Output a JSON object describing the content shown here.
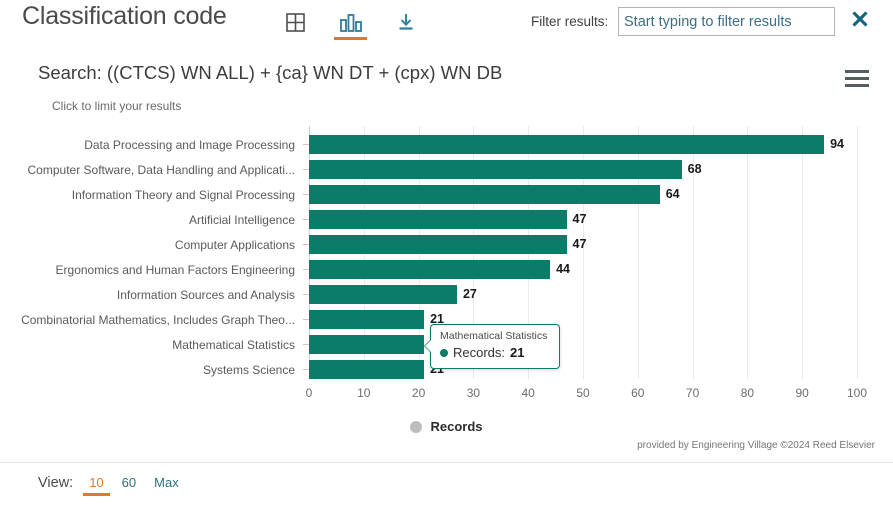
{
  "header": {
    "title": "Classification code",
    "icons": [
      {
        "name": "table-view-icon",
        "label": "Table view",
        "active": false
      },
      {
        "name": "bar-chart-view-icon",
        "label": "Bar chart view",
        "active": true
      },
      {
        "name": "download-icon",
        "label": "Download",
        "active": false
      }
    ],
    "filter_label": "Filter results:",
    "filter_placeholder": "Start typing to filter results",
    "filter_value": "",
    "close_label": "Close"
  },
  "search": {
    "line": "Search: ((CTCS) WN ALL) + {ca} WN DT + (cpx) WN DB",
    "hint": "Click to limit your results",
    "menu_label": "Options menu"
  },
  "chart_data": {
    "type": "bar",
    "orientation": "horizontal",
    "title": "",
    "xlabel": "",
    "ylabel": "",
    "xlim": [
      0,
      100
    ],
    "xticks": [
      0,
      10,
      20,
      30,
      40,
      50,
      60,
      70,
      80,
      90,
      100
    ],
    "grid": true,
    "legend": [
      "Records"
    ],
    "legend_position": "bottom",
    "series_color": "#0b7c68",
    "categories": [
      "Data Processing and Image Processing",
      "Computer Software, Data Handling and Applicati...",
      "Information Theory and Signal Processing",
      "Artificial Intelligence",
      "Computer Applications",
      "Ergonomics and Human Factors Engineering",
      "Information Sources and Analysis",
      "Combinatorial Mathematics, Includes Graph Theo...",
      "Mathematical Statistics",
      "Systems Science"
    ],
    "values": [
      94,
      68,
      64,
      47,
      47,
      44,
      27,
      21,
      21,
      21
    ],
    "series": [
      {
        "name": "Records",
        "values": [
          94,
          68,
          64,
          47,
          47,
          44,
          27,
          21,
          21,
          21
        ]
      }
    ]
  },
  "tooltip": {
    "title": "Mathematical Statistics",
    "series_label": "Records:",
    "value": "21"
  },
  "footer": {
    "provider": "provided by Engineering Village ©2024 Reed Elsevier",
    "view_label": "View:",
    "view_options": [
      {
        "label": "10",
        "active": true
      },
      {
        "label": "60",
        "active": false
      },
      {
        "label": "Max",
        "active": false
      }
    ]
  },
  "colors": {
    "bar": "#0b7c68",
    "accent": "#e87722",
    "link": "#2e6e87",
    "legend_dot": "#bdbdbd"
  }
}
